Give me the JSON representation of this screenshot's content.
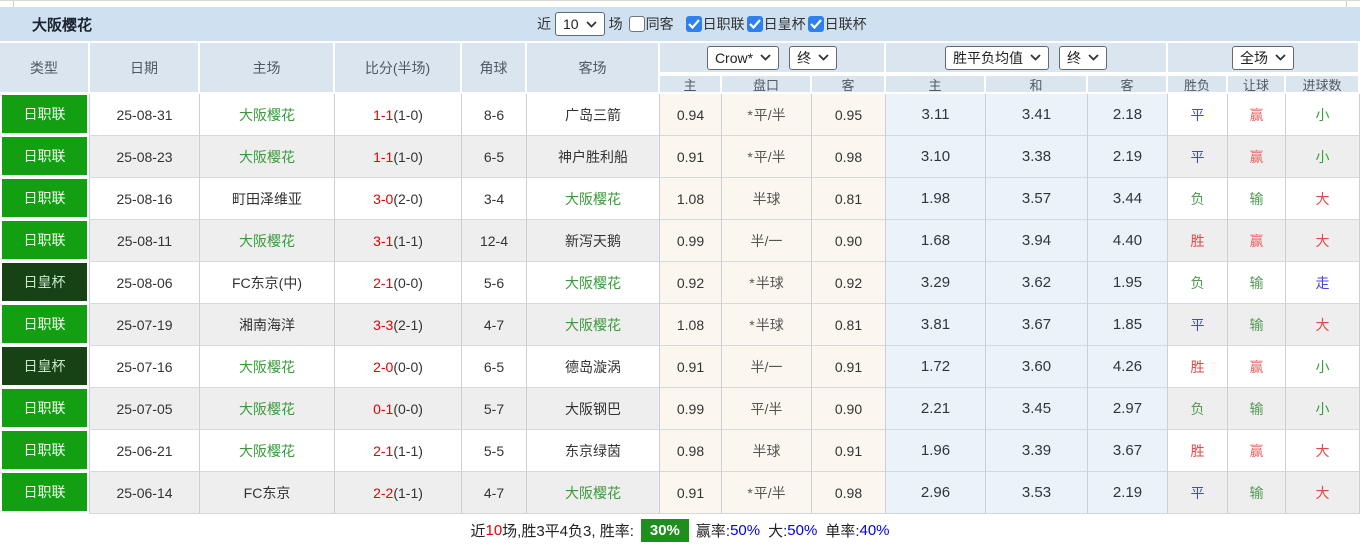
{
  "topbar": {
    "team_title": "大阪樱花",
    "recent_label": "近",
    "recent_value": "10",
    "games_label": "场",
    "same_away_label": "同客",
    "filters": [
      {
        "label": "日职联",
        "checked": true
      },
      {
        "label": "日皇杯",
        "checked": true
      },
      {
        "label": "日联杯",
        "checked": true
      }
    ]
  },
  "table": {
    "columns": [
      "类型",
      "日期",
      "主场",
      "比分(半场)",
      "角球",
      "客场"
    ],
    "selects": {
      "company": "Crow*",
      "company_time": "终",
      "average": "胜平负均值",
      "average_time": "终",
      "scope": "全场"
    },
    "sub_columns": [
      "主",
      "盘口",
      "客",
      "主",
      "和",
      "客",
      "胜负",
      "让球",
      "进球数"
    ],
    "rows": [
      {
        "type": "日职联",
        "is_cup": false,
        "date": "25-08-31",
        "home": "大阪樱花",
        "home_is_focus": true,
        "score": "1-1",
        "half": "(1-0)",
        "corners": "8-6",
        "away": "广岛三箭",
        "away_is_focus": false,
        "odds_home": "0.94",
        "handicap_star": true,
        "handicap": "平/半",
        "odds_away": "0.95",
        "avg_home": "3.11",
        "avg_draw": "3.41",
        "avg_away": "2.18",
        "result": "平",
        "handicap_result": "赢",
        "goals": "小"
      },
      {
        "type": "日职联",
        "is_cup": false,
        "date": "25-08-23",
        "home": "大阪樱花",
        "home_is_focus": true,
        "score": "1-1",
        "half": "(1-0)",
        "corners": "6-5",
        "away": "神户胜利船",
        "away_is_focus": false,
        "odds_home": "0.91",
        "handicap_star": true,
        "handicap": "平/半",
        "odds_away": "0.98",
        "avg_home": "3.10",
        "avg_draw": "3.38",
        "avg_away": "2.19",
        "result": "平",
        "handicap_result": "赢",
        "goals": "小"
      },
      {
        "type": "日职联",
        "is_cup": false,
        "date": "25-08-16",
        "home": "町田泽维亚",
        "home_is_focus": false,
        "score": "3-0",
        "half": "(2-0)",
        "corners": "3-4",
        "away": "大阪樱花",
        "away_is_focus": true,
        "odds_home": "1.08",
        "handicap_star": false,
        "handicap": "半球",
        "odds_away": "0.81",
        "avg_home": "1.98",
        "avg_draw": "3.57",
        "avg_away": "3.44",
        "result": "负",
        "handicap_result": "输",
        "goals": "大"
      },
      {
        "type": "日职联",
        "is_cup": false,
        "date": "25-08-11",
        "home": "大阪樱花",
        "home_is_focus": true,
        "score": "3-1",
        "half": "(1-1)",
        "corners": "12-4",
        "away": "新泻天鹅",
        "away_is_focus": false,
        "odds_home": "0.99",
        "handicap_star": false,
        "handicap": "半/一",
        "odds_away": "0.90",
        "avg_home": "1.68",
        "avg_draw": "3.94",
        "avg_away": "4.40",
        "result": "胜",
        "handicap_result": "赢",
        "goals": "大"
      },
      {
        "type": "日皇杯",
        "is_cup": true,
        "date": "25-08-06",
        "home": "FC东京(中)",
        "home_is_focus": false,
        "score": "2-1",
        "half": "(0-0)",
        "corners": "5-6",
        "away": "大阪樱花",
        "away_is_focus": true,
        "odds_home": "0.92",
        "handicap_star": true,
        "handicap": "半球",
        "odds_away": "0.92",
        "avg_home": "3.29",
        "avg_draw": "3.62",
        "avg_away": "1.95",
        "result": "负",
        "handicap_result": "输",
        "goals": "走"
      },
      {
        "type": "日职联",
        "is_cup": false,
        "date": "25-07-19",
        "home": "湘南海洋",
        "home_is_focus": false,
        "score": "3-3",
        "half": "(2-1)",
        "corners": "4-7",
        "away": "大阪樱花",
        "away_is_focus": true,
        "odds_home": "1.08",
        "handicap_star": true,
        "handicap": "半球",
        "odds_away": "0.81",
        "avg_home": "3.81",
        "avg_draw": "3.67",
        "avg_away": "1.85",
        "result": "平",
        "handicap_result": "输",
        "goals": "大"
      },
      {
        "type": "日皇杯",
        "is_cup": true,
        "date": "25-07-16",
        "home": "大阪樱花",
        "home_is_focus": true,
        "score": "2-0",
        "half": "(0-0)",
        "corners": "6-5",
        "away": "德岛漩涡",
        "away_is_focus": false,
        "odds_home": "0.91",
        "handicap_star": false,
        "handicap": "半/一",
        "odds_away": "0.91",
        "avg_home": "1.72",
        "avg_draw": "3.60",
        "avg_away": "4.26",
        "result": "胜",
        "handicap_result": "赢",
        "goals": "小"
      },
      {
        "type": "日职联",
        "is_cup": false,
        "date": "25-07-05",
        "home": "大阪樱花",
        "home_is_focus": true,
        "score": "0-1",
        "half": "(0-0)",
        "corners": "5-7",
        "away": "大阪钢巴",
        "away_is_focus": false,
        "odds_home": "0.99",
        "handicap_star": false,
        "handicap": "平/半",
        "odds_away": "0.90",
        "avg_home": "2.21",
        "avg_draw": "3.45",
        "avg_away": "2.97",
        "result": "负",
        "handicap_result": "输",
        "goals": "小"
      },
      {
        "type": "日职联",
        "is_cup": false,
        "date": "25-06-21",
        "home": "大阪樱花",
        "home_is_focus": true,
        "score": "2-1",
        "half": "(1-1)",
        "corners": "5-5",
        "away": "东京绿茵",
        "away_is_focus": false,
        "odds_home": "0.98",
        "handicap_star": false,
        "handicap": "半球",
        "odds_away": "0.91",
        "avg_home": "1.96",
        "avg_draw": "3.39",
        "avg_away": "3.67",
        "result": "胜",
        "handicap_result": "赢",
        "goals": "大"
      },
      {
        "type": "日职联",
        "is_cup": false,
        "date": "25-06-14",
        "home": "FC东京",
        "home_is_focus": false,
        "score": "2-2",
        "half": "(1-1)",
        "corners": "4-7",
        "away": "大阪樱花",
        "away_is_focus": true,
        "odds_home": "0.91",
        "handicap_star": true,
        "handicap": "平/半",
        "odds_away": "0.98",
        "avg_home": "2.96",
        "avg_draw": "3.53",
        "avg_away": "2.19",
        "result": "平",
        "handicap_result": "输",
        "goals": "大"
      }
    ]
  },
  "footer": {
    "prefix": "近",
    "count": "10",
    "summary": "场,胜3平4负3, 胜率:",
    "win_rate": "30%",
    "let_label": "赢率:",
    "let_rate": "50%",
    "big_label": "大:",
    "big_rate": "50%",
    "single_label": "单率:",
    "single_rate": "40%"
  },
  "colors": {
    "league_badge": "#12a012",
    "cup_badge": "#164216",
    "team_green": "#3a9a3a",
    "score_red": "#e60000",
    "win_red": "#e34848",
    "let_win_red": "#ef6666",
    "draw_blue": "#4646dc",
    "lose_green": "#559a55",
    "small_green": "#37a037",
    "chip_green": "#1e8e1e",
    "footer_blue": "#0000e0"
  }
}
